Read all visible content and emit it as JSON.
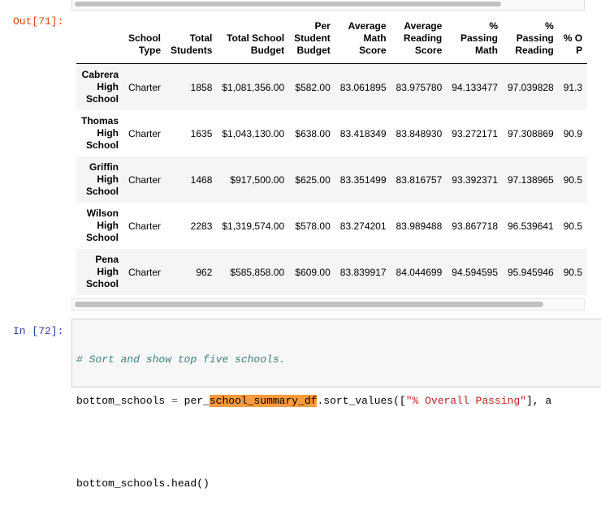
{
  "out_prompt": "Out[71]:",
  "in_prompt": "In [72]:",
  "table": {
    "headers": [
      "",
      "School Type",
      "Total Students",
      "Total School Budget",
      "Per Student Budget",
      "Average Math Score",
      "Average Reading Score",
      "% Passing Math",
      "% Passing Reading",
      "% O P"
    ],
    "header_lines": [
      [
        ""
      ],
      [
        "School",
        "Type"
      ],
      [
        "Total",
        "Students"
      ],
      [
        "Total School",
        "Budget"
      ],
      [
        "Per",
        "Student",
        "Budget"
      ],
      [
        "Average",
        "Math",
        "Score"
      ],
      [
        "Average",
        "Reading",
        "Score"
      ],
      [
        "%",
        "Passing",
        "Math"
      ],
      [
        "%",
        "Passing",
        "Reading"
      ],
      [
        "% O",
        "P"
      ]
    ],
    "rows": [
      {
        "index": [
          "Cabrera",
          "High",
          "School"
        ],
        "cells": [
          "Charter",
          "1858",
          "$1,081,356.00",
          "$582.00",
          "83.061895",
          "83.975780",
          "94.133477",
          "97.039828",
          "91.3"
        ]
      },
      {
        "index": [
          "Thomas",
          "High",
          "School"
        ],
        "cells": [
          "Charter",
          "1635",
          "$1,043,130.00",
          "$638.00",
          "83.418349",
          "83.848930",
          "93.272171",
          "97.308869",
          "90.9"
        ]
      },
      {
        "index": [
          "Griffin",
          "High",
          "School"
        ],
        "cells": [
          "Charter",
          "1468",
          "$917,500.00",
          "$625.00",
          "83.351499",
          "83.816757",
          "93.392371",
          "97.138965",
          "90.5"
        ]
      },
      {
        "index": [
          "Wilson",
          "High",
          "School"
        ],
        "cells": [
          "Charter",
          "2283",
          "$1,319,574.00",
          "$578.00",
          "83.274201",
          "83.989488",
          "93.867718",
          "96.539641",
          "90.5"
        ]
      },
      {
        "index": [
          "Pena",
          "High",
          "School"
        ],
        "cells": [
          "Charter",
          "962",
          "$585,858.00",
          "$609.00",
          "83.839917",
          "84.044699",
          "94.594595",
          "95.945946",
          "90.5"
        ]
      }
    ]
  },
  "code": {
    "comment": "# Sort and show top five schools.",
    "line2_a": "bottom_schools ",
    "line2_eq": "=",
    "line2_b": " per_",
    "line2_hl": "school_summary_df",
    "line2_c": ".sort_values([",
    "line2_str": "\"% Overall Passing\"",
    "line2_d": "], a",
    "line4": "bottom_schools.head()"
  }
}
